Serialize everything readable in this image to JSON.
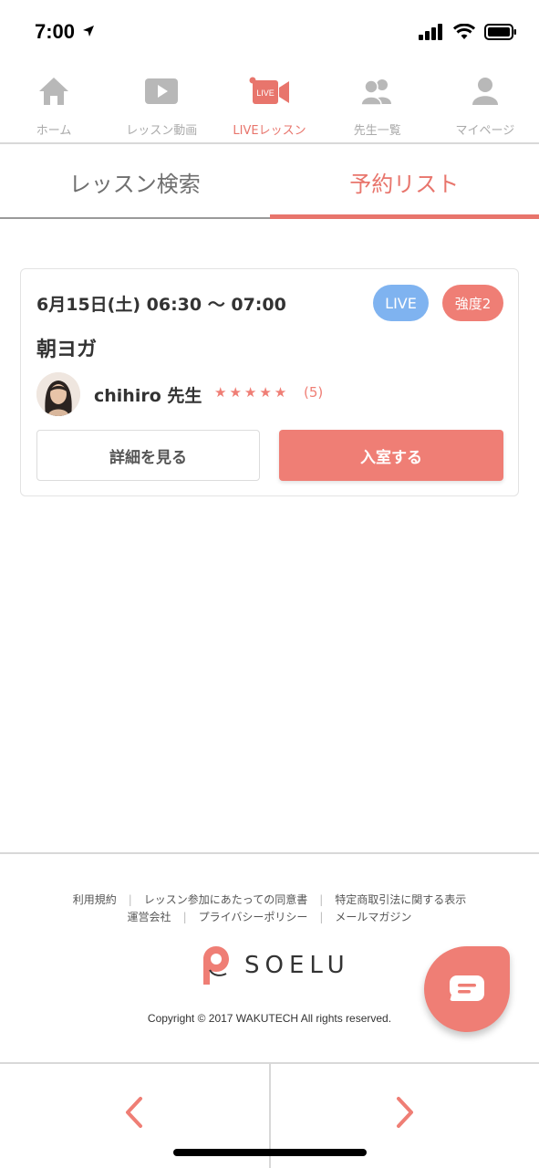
{
  "status_bar": {
    "time": "7:00"
  },
  "top_nav": {
    "items": [
      {
        "label": "ホーム",
        "icon": "home-icon"
      },
      {
        "label": "レッスン動画",
        "icon": "play-video-icon"
      },
      {
        "label": "LIVEレッスン",
        "icon": "live-camera-icon",
        "icon_text": "LIVE",
        "active": true
      },
      {
        "label": "先生一覧",
        "icon": "teachers-icon"
      },
      {
        "label": "マイページ",
        "icon": "user-icon"
      }
    ]
  },
  "tabs": {
    "search": "レッスン検索",
    "reservations": "予約リスト",
    "active": "reservations"
  },
  "lesson": {
    "datetime": "6月15日(土) 06:30 〜 07:00",
    "live_badge": "LIVE",
    "intensity_badge": "強度2",
    "title": "朝ヨガ",
    "teacher": "chihiro 先生",
    "stars": "★★★★★",
    "rating": 5,
    "review_count": "(5)",
    "detail_button": "詳細を見る",
    "enter_button": "入室する"
  },
  "footer": {
    "links_row1": [
      "利用規約",
      "レッスン参加にあたっての同意書",
      "特定商取引法に関する表示"
    ],
    "links_row2": [
      "運営会社",
      "プライバシーポリシー",
      "メールマガジン"
    ],
    "logo_text": "SOELU",
    "copyright": "Copyright © 2017 WAKUTECH All rights reserved."
  },
  "colors": {
    "accent": "#e8756c",
    "live_badge": "#7fb3f0",
    "inactive_icon": "#b8b8b8"
  }
}
